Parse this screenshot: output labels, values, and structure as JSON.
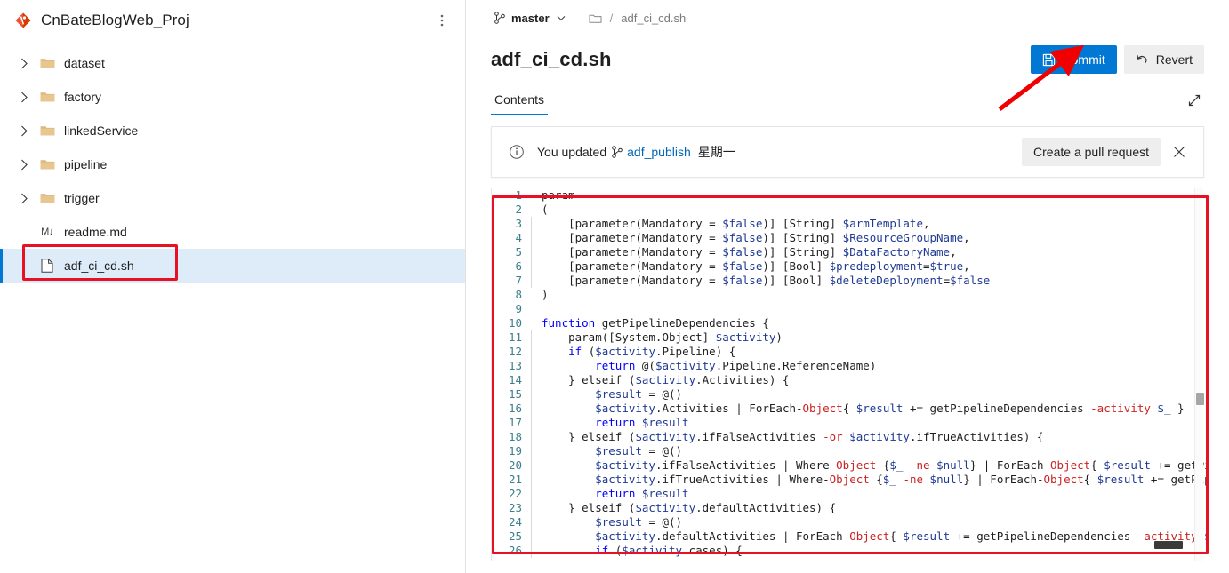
{
  "sidebar": {
    "repo_name": "CnBateBlogWeb_Proj",
    "logo_icon": "azure-repos-diamond-icon",
    "more_icon": "more-vertical-icon",
    "items": [
      {
        "label": "dataset",
        "icon": "folder-icon",
        "type": "folder",
        "expandable": true,
        "selected": false
      },
      {
        "label": "factory",
        "icon": "folder-icon",
        "type": "folder",
        "expandable": true,
        "selected": false
      },
      {
        "label": "linkedService",
        "icon": "folder-icon",
        "type": "folder",
        "expandable": true,
        "selected": false
      },
      {
        "label": "pipeline",
        "icon": "folder-icon",
        "type": "folder",
        "expandable": true,
        "selected": false
      },
      {
        "label": "trigger",
        "icon": "folder-icon",
        "type": "folder",
        "expandable": true,
        "selected": false
      },
      {
        "label": "readme.md",
        "icon": "markdown-icon",
        "type": "file",
        "expandable": false,
        "selected": false,
        "badge": "M↓"
      },
      {
        "label": "adf_ci_cd.sh",
        "icon": "file-icon",
        "type": "file",
        "expandable": false,
        "selected": true
      }
    ]
  },
  "breadcrumb": {
    "branch_icon": "branch-icon",
    "branch": "master",
    "caret_icon": "chevron-down-icon",
    "folder_icon": "folder-outline-icon",
    "separator": "/",
    "file": "adf_ci_cd.sh"
  },
  "header": {
    "title": "adf_ci_cd.sh",
    "commit_label": "Commit",
    "commit_icon": "save-icon",
    "revert_label": "Revert",
    "revert_icon": "undo-icon",
    "expand_icon": "expand-diagonal-icon"
  },
  "tabs": [
    {
      "label": "Contents",
      "active": true
    }
  ],
  "notice": {
    "info_icon": "info-circle-icon",
    "prefix": "You updated",
    "branch_icon": "branch-icon",
    "branch_link": "adf_publish",
    "suffix": "星期一",
    "action_label": "Create a pull request",
    "close_icon": "close-icon"
  },
  "colors": {
    "accent": "#0078d4",
    "annotation": "#e81123",
    "selection": "#deecf9",
    "keyword": "#0000ff",
    "variable": "#1f3a93",
    "operator": "#cc2222",
    "linenumber": "#3d7f8c"
  },
  "code": {
    "language": "powershell",
    "first_visible_line": 1,
    "last_visible_line": 26,
    "lines": [
      {
        "n": 1,
        "indent_guide": false,
        "tokens": [
          {
            "t": "param",
            "c": "p"
          }
        ]
      },
      {
        "n": 2,
        "indent_guide": false,
        "tokens": [
          {
            "t": "(",
            "c": "p"
          }
        ]
      },
      {
        "n": 3,
        "indent_guide": true,
        "tokens": [
          {
            "t": "    [parameter(Mandatory = ",
            "c": "p"
          },
          {
            "t": "$false",
            "c": "v"
          },
          {
            "t": ")] [String] ",
            "c": "p"
          },
          {
            "t": "$armTemplate",
            "c": "v"
          },
          {
            "t": ",",
            "c": "p"
          }
        ]
      },
      {
        "n": 4,
        "indent_guide": true,
        "tokens": [
          {
            "t": "    [parameter(Mandatory = ",
            "c": "p"
          },
          {
            "t": "$false",
            "c": "v"
          },
          {
            "t": ")] [String] ",
            "c": "p"
          },
          {
            "t": "$ResourceGroupName",
            "c": "v"
          },
          {
            "t": ",",
            "c": "p"
          }
        ]
      },
      {
        "n": 5,
        "indent_guide": true,
        "tokens": [
          {
            "t": "    [parameter(Mandatory = ",
            "c": "p"
          },
          {
            "t": "$false",
            "c": "v"
          },
          {
            "t": ")] [String] ",
            "c": "p"
          },
          {
            "t": "$DataFactoryName",
            "c": "v"
          },
          {
            "t": ",",
            "c": "p"
          }
        ]
      },
      {
        "n": 6,
        "indent_guide": true,
        "tokens": [
          {
            "t": "    [parameter(Mandatory = ",
            "c": "p"
          },
          {
            "t": "$false",
            "c": "v"
          },
          {
            "t": ")] [Bool] ",
            "c": "p"
          },
          {
            "t": "$predeployment",
            "c": "v"
          },
          {
            "t": "=",
            "c": "p"
          },
          {
            "t": "$true",
            "c": "v"
          },
          {
            "t": ",",
            "c": "p"
          }
        ]
      },
      {
        "n": 7,
        "indent_guide": true,
        "tokens": [
          {
            "t": "    [parameter(Mandatory = ",
            "c": "p"
          },
          {
            "t": "$false",
            "c": "v"
          },
          {
            "t": ")] [Bool] ",
            "c": "p"
          },
          {
            "t": "$deleteDeployment",
            "c": "v"
          },
          {
            "t": "=",
            "c": "p"
          },
          {
            "t": "$false",
            "c": "v"
          }
        ]
      },
      {
        "n": 8,
        "indent_guide": false,
        "tokens": [
          {
            "t": ")",
            "c": "p"
          }
        ]
      },
      {
        "n": 9,
        "indent_guide": false,
        "tokens": [
          {
            "t": "",
            "c": "p"
          }
        ]
      },
      {
        "n": 10,
        "indent_guide": false,
        "tokens": [
          {
            "t": "function",
            "c": "k"
          },
          {
            "t": " getPipelineDependencies {",
            "c": "p"
          }
        ]
      },
      {
        "n": 11,
        "indent_guide": true,
        "tokens": [
          {
            "t": "    param([System.Object] ",
            "c": "p"
          },
          {
            "t": "$activity",
            "c": "v"
          },
          {
            "t": ")",
            "c": "p"
          }
        ]
      },
      {
        "n": 12,
        "indent_guide": true,
        "tokens": [
          {
            "t": "    ",
            "c": "p"
          },
          {
            "t": "if",
            "c": "k"
          },
          {
            "t": " (",
            "c": "p"
          },
          {
            "t": "$activity",
            "c": "v"
          },
          {
            "t": ".Pipeline) {",
            "c": "p"
          }
        ]
      },
      {
        "n": 13,
        "indent_guide": true,
        "tokens": [
          {
            "t": "        ",
            "c": "p"
          },
          {
            "t": "return",
            "c": "k"
          },
          {
            "t": " @(",
            "c": "p"
          },
          {
            "t": "$activity",
            "c": "v"
          },
          {
            "t": ".Pipeline.ReferenceName)",
            "c": "p"
          }
        ]
      },
      {
        "n": 14,
        "indent_guide": true,
        "tokens": [
          {
            "t": "    } elseif (",
            "c": "p"
          },
          {
            "t": "$activity",
            "c": "v"
          },
          {
            "t": ".Activities) {",
            "c": "p"
          }
        ]
      },
      {
        "n": 15,
        "indent_guide": true,
        "tokens": [
          {
            "t": "        ",
            "c": "p"
          },
          {
            "t": "$result",
            "c": "v"
          },
          {
            "t": " = @()",
            "c": "p"
          }
        ]
      },
      {
        "n": 16,
        "indent_guide": true,
        "tokens": [
          {
            "t": "        ",
            "c": "p"
          },
          {
            "t": "$activity",
            "c": "v"
          },
          {
            "t": ".Activities | ForEach-",
            "c": "p"
          },
          {
            "t": "Object",
            "c": "o"
          },
          {
            "t": "{ ",
            "c": "p"
          },
          {
            "t": "$result",
            "c": "v"
          },
          {
            "t": " += getPipelineDependencies ",
            "c": "p"
          },
          {
            "t": "-activity",
            "c": "o"
          },
          {
            "t": " ",
            "c": "p"
          },
          {
            "t": "$_",
            "c": "v"
          },
          {
            "t": " }",
            "c": "p"
          }
        ]
      },
      {
        "n": 17,
        "indent_guide": true,
        "tokens": [
          {
            "t": "        ",
            "c": "p"
          },
          {
            "t": "return",
            "c": "k"
          },
          {
            "t": " ",
            "c": "p"
          },
          {
            "t": "$result",
            "c": "v"
          }
        ]
      },
      {
        "n": 18,
        "indent_guide": true,
        "tokens": [
          {
            "t": "    } elseif (",
            "c": "p"
          },
          {
            "t": "$activity",
            "c": "v"
          },
          {
            "t": ".ifFalseActivities ",
            "c": "p"
          },
          {
            "t": "-or",
            "c": "o"
          },
          {
            "t": " ",
            "c": "p"
          },
          {
            "t": "$activity",
            "c": "v"
          },
          {
            "t": ".ifTrueActivities) {",
            "c": "p"
          }
        ]
      },
      {
        "n": 19,
        "indent_guide": true,
        "tokens": [
          {
            "t": "        ",
            "c": "p"
          },
          {
            "t": "$result",
            "c": "v"
          },
          {
            "t": " = @()",
            "c": "p"
          }
        ]
      },
      {
        "n": 20,
        "indent_guide": true,
        "tokens": [
          {
            "t": "        ",
            "c": "p"
          },
          {
            "t": "$activity",
            "c": "v"
          },
          {
            "t": ".ifFalseActivities | Where-",
            "c": "p"
          },
          {
            "t": "Object",
            "c": "o"
          },
          {
            "t": " {",
            "c": "p"
          },
          {
            "t": "$_",
            "c": "v"
          },
          {
            "t": " ",
            "c": "p"
          },
          {
            "t": "-ne",
            "c": "o"
          },
          {
            "t": " ",
            "c": "p"
          },
          {
            "t": "$null",
            "c": "v"
          },
          {
            "t": "} | ForEach-",
            "c": "p"
          },
          {
            "t": "Object",
            "c": "o"
          },
          {
            "t": "{ ",
            "c": "p"
          },
          {
            "t": "$result",
            "c": "v"
          },
          {
            "t": " += getPipelineDependenc",
            "c": "p"
          }
        ]
      },
      {
        "n": 21,
        "indent_guide": true,
        "tokens": [
          {
            "t": "        ",
            "c": "p"
          },
          {
            "t": "$activity",
            "c": "v"
          },
          {
            "t": ".ifTrueActivities | Where-",
            "c": "p"
          },
          {
            "t": "Object",
            "c": "o"
          },
          {
            "t": " {",
            "c": "p"
          },
          {
            "t": "$_",
            "c": "v"
          },
          {
            "t": " ",
            "c": "p"
          },
          {
            "t": "-ne",
            "c": "o"
          },
          {
            "t": " ",
            "c": "p"
          },
          {
            "t": "$null",
            "c": "v"
          },
          {
            "t": "} | ForEach-",
            "c": "p"
          },
          {
            "t": "Object",
            "c": "o"
          },
          {
            "t": "{ ",
            "c": "p"
          },
          {
            "t": "$result",
            "c": "v"
          },
          {
            "t": " += getPipelineDependenci",
            "c": "p"
          }
        ]
      },
      {
        "n": 22,
        "indent_guide": true,
        "tokens": [
          {
            "t": "        ",
            "c": "p"
          },
          {
            "t": "return",
            "c": "k"
          },
          {
            "t": " ",
            "c": "p"
          },
          {
            "t": "$result",
            "c": "v"
          }
        ]
      },
      {
        "n": 23,
        "indent_guide": true,
        "tokens": [
          {
            "t": "    } elseif (",
            "c": "p"
          },
          {
            "t": "$activity",
            "c": "v"
          },
          {
            "t": ".defaultActivities) {",
            "c": "p"
          }
        ]
      },
      {
        "n": 24,
        "indent_guide": true,
        "tokens": [
          {
            "t": "        ",
            "c": "p"
          },
          {
            "t": "$result",
            "c": "v"
          },
          {
            "t": " = @()",
            "c": "p"
          }
        ]
      },
      {
        "n": 25,
        "indent_guide": true,
        "tokens": [
          {
            "t": "        ",
            "c": "p"
          },
          {
            "t": "$activity",
            "c": "v"
          },
          {
            "t": ".defaultActivities | ForEach-",
            "c": "p"
          },
          {
            "t": "Object",
            "c": "o"
          },
          {
            "t": "{ ",
            "c": "p"
          },
          {
            "t": "$result",
            "c": "v"
          },
          {
            "t": " += getPipelineDependencies ",
            "c": "p"
          },
          {
            "t": "-activity",
            "c": "o"
          },
          {
            "t": " ",
            "c": "p"
          },
          {
            "t": "$_",
            "c": "v"
          },
          {
            "t": " }",
            "c": "p"
          }
        ]
      },
      {
        "n": 26,
        "indent_guide": true,
        "tokens": [
          {
            "t": "        ",
            "c": "p"
          },
          {
            "t": "if",
            "c": "k"
          },
          {
            "t": " (",
            "c": "p"
          },
          {
            "t": "$activity",
            "c": "v"
          },
          {
            "t": ".cases) {",
            "c": "p"
          }
        ]
      }
    ]
  },
  "annotations": [
    {
      "name": "red-box-around-selected-file",
      "shape": "rectangle",
      "color": "#e81123"
    },
    {
      "name": "red-box-around-code-editor",
      "shape": "rectangle",
      "color": "#e81123"
    },
    {
      "name": "red-arrow-to-commit-button",
      "shape": "arrow",
      "color": "#e81123"
    }
  ]
}
